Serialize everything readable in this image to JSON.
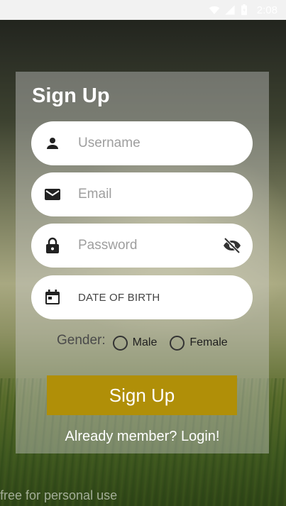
{
  "status_bar": {
    "time": "2:08",
    "icons": [
      "wifi-icon",
      "signal-icon",
      "battery-icon"
    ]
  },
  "form": {
    "title": "Sign Up",
    "username_placeholder": "Username",
    "email_placeholder": "Email",
    "password_placeholder": "Password",
    "dob_label": "DATE OF BIRTH",
    "gender_label": "Gender:",
    "gender_options": [
      "Male",
      "Female"
    ],
    "submit_label": "Sign Up",
    "login_link": "Already member? Login!"
  },
  "watermark": "free for personal use",
  "colors": {
    "accent": "#b08f08",
    "card": "rgba(205,205,205,0.42)",
    "field_bg": "#ffffff"
  }
}
